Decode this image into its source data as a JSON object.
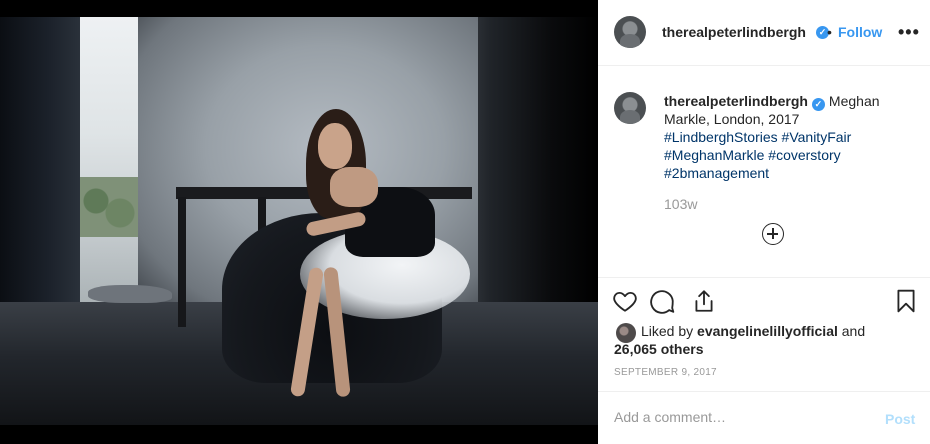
{
  "post": {
    "image_alt": "Photo by therealpeterlindbergh",
    "header": {
      "username": "therealpeterlindbergh",
      "verified_icon": "verified-badge-icon",
      "separator": "•",
      "follow_label": "Follow",
      "more_label": "•••"
    },
    "caption": {
      "username": "therealpeterlindbergh",
      "text": "Meghan Markle, London, 2017",
      "hashtags": [
        "#LindberghStories",
        "#VanityFair",
        "#MeghanMarkle",
        "#coverstory",
        "#2bmanagement"
      ],
      "time_ago": "103w"
    },
    "actions": {
      "like_icon": "heart-icon",
      "comment_icon": "comment-icon",
      "share_icon": "share-icon",
      "save_icon": "bookmark-icon"
    },
    "likes": {
      "prefix": "Liked by",
      "user": "evangelinelillyofficial",
      "conjunction": "and",
      "others": "26,065 others"
    },
    "date": "September 9, 2017",
    "comment": {
      "placeholder": "Add a comment…",
      "post_label": "Post"
    }
  },
  "colors": {
    "accent": "#3897f0",
    "hashtag": "#003569",
    "muted": "#999999",
    "post_disabled": "#b2dffc"
  }
}
